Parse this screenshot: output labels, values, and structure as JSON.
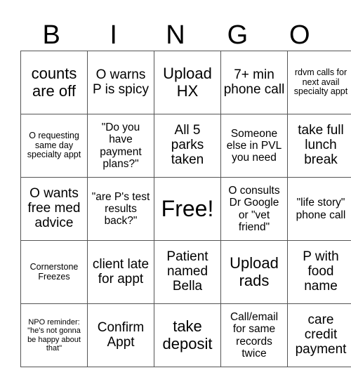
{
  "header": [
    "B",
    "I",
    "N",
    "G",
    "O"
  ],
  "rows": [
    [
      {
        "text": "counts are off",
        "size": "s-l"
      },
      {
        "text": "O warns P is spicy",
        "size": "s-m"
      },
      {
        "text": "Upload HX",
        "size": "s-l"
      },
      {
        "text": "7+ min phone call",
        "size": "s-m"
      },
      {
        "text": "rdvm calls for next avail specialty appt",
        "size": "s-xs"
      }
    ],
    [
      {
        "text": "O requesting same day specialty appt",
        "size": "s-xs"
      },
      {
        "text": "\"Do you have payment plans?\"",
        "size": "s-sm"
      },
      {
        "text": "All 5 parks taken",
        "size": "s-m"
      },
      {
        "text": "Someone else in PVL you need",
        "size": "s-sm"
      },
      {
        "text": "take full lunch break",
        "size": "s-m"
      }
    ],
    [
      {
        "text": "O wants free med advice",
        "size": "s-m"
      },
      {
        "text": "\"are P's test results back?\"",
        "size": "s-sm"
      },
      {
        "text": "Free!",
        "size": "s-xl"
      },
      {
        "text": "O consults Dr Google or \"vet friend\"",
        "size": "s-sm"
      },
      {
        "text": "\"life story\" phone call",
        "size": "s-sm"
      }
    ],
    [
      {
        "text": "Cornerstone Freezes",
        "size": "s-xs"
      },
      {
        "text": "client late for appt",
        "size": "s-m"
      },
      {
        "text": "Patient named Bella",
        "size": "s-m"
      },
      {
        "text": "Upload rads",
        "size": "s-l"
      },
      {
        "text": "P with food name",
        "size": "s-m"
      }
    ],
    [
      {
        "text": "NPO reminder: \"he's not gonna be happy about that\"",
        "size": "s-xxs"
      },
      {
        "text": "Confirm Appt",
        "size": "s-m"
      },
      {
        "text": "take deposit",
        "size": "s-l"
      },
      {
        "text": "Call/email for same records twice",
        "size": "s-sm"
      },
      {
        "text": "care credit payment",
        "size": "s-m"
      }
    ]
  ]
}
